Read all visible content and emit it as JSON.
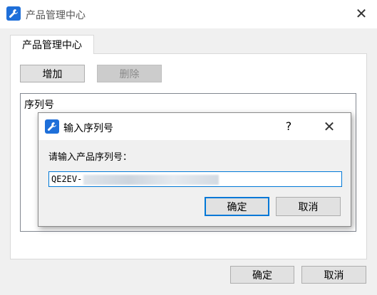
{
  "window": {
    "title": "产品管理中心",
    "close_glyph": "✕"
  },
  "tabs": [
    {
      "label": "产品管理中心"
    }
  ],
  "toolbar": {
    "add_label": "增加",
    "delete_label": "删除"
  },
  "list": {
    "column_header": "序列号"
  },
  "dialog": {
    "title": "输入序列号",
    "help_glyph": "?",
    "close_glyph": "✕",
    "prompt": "请输入产品序列号：",
    "input_value_prefix": "QE2EV-",
    "ok_label": "确定",
    "cancel_label": "取消"
  },
  "footer": {
    "ok_label": "确定",
    "cancel_label": "取消"
  },
  "colors": {
    "accent": "#0078d7",
    "icon_bg": "#1e6fd9"
  },
  "icons": {
    "app": "wrench-icon"
  }
}
